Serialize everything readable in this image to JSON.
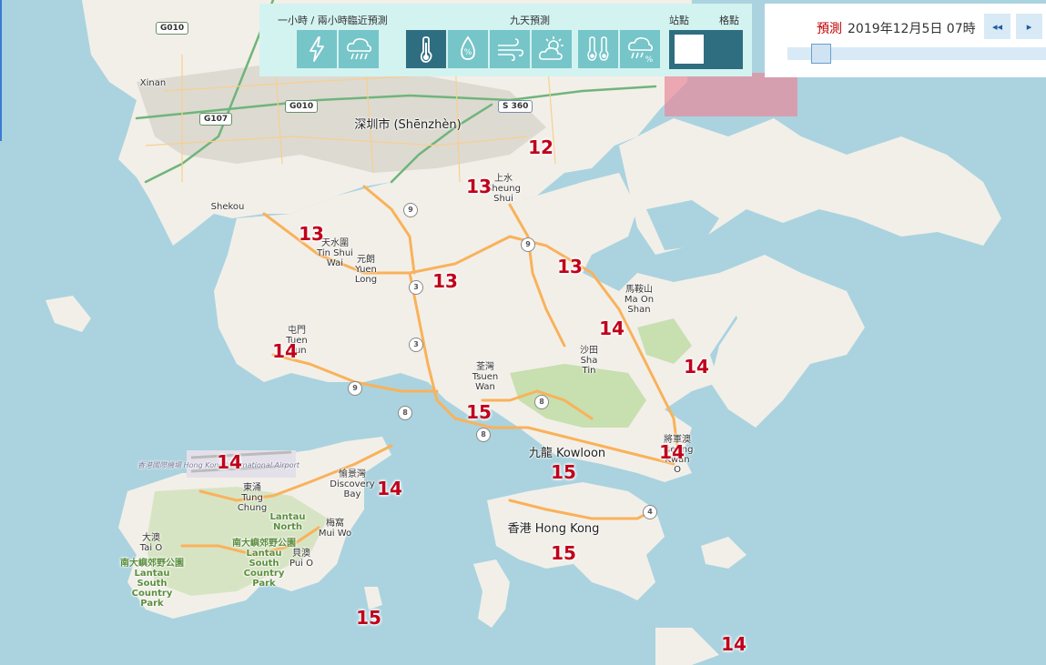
{
  "toolbar": {
    "group_nowcast": "一小時 / 兩小時臨近預測",
    "group_nineday": "九天預測",
    "group_station": "站點",
    "group_grid": "格點",
    "buttons": [
      {
        "name": "lightning-icon",
        "selected": false
      },
      {
        "name": "rain-cloud-icon",
        "selected": false
      },
      {
        "name": "thermometer-icon",
        "selected": true
      },
      {
        "name": "humidity-drop-icon",
        "selected": false
      },
      {
        "name": "wind-icon",
        "selected": false
      },
      {
        "name": "sun-cloud-icon",
        "selected": false
      },
      {
        "name": "max-min-temperature-icon",
        "selected": false
      },
      {
        "name": "rain-probability-icon",
        "selected": false
      }
    ]
  },
  "timepanel": {
    "label": "預測",
    "time": "2019年12月5日 07時",
    "prev_label": "◂◂",
    "next_label": "▸",
    "slider_position_fraction": 0.1
  },
  "places": [
    {
      "name": "place-xinan",
      "text": "Xinan"
    },
    {
      "name": "place-shenzhen",
      "text": "深圳市 (Shēnzhèn)"
    },
    {
      "name": "place-shekou",
      "text": "Shekou"
    },
    {
      "name": "place-sheung-shui",
      "text": "上水\nSheung\nShui"
    },
    {
      "name": "place-tin-shui-wai",
      "text": "天水圍\nTin Shui\nWai"
    },
    {
      "name": "place-yuen-long",
      "text": "元朗\nYuen\nLong"
    },
    {
      "name": "place-ma-on-shan",
      "text": "馬鞍山\nMa On\nShan"
    },
    {
      "name": "place-tuen-mun",
      "text": "屯門\nTuen\nMun"
    },
    {
      "name": "place-sha-tin",
      "text": "沙田\nSha\nTin"
    },
    {
      "name": "place-tsuen-wan",
      "text": "荃灣\nTsuen\nWan"
    },
    {
      "name": "place-kowloon",
      "text": "九龍 Kowloon"
    },
    {
      "name": "place-tseung-kwan-o",
      "text": "將軍澳\nTseung\nKwan\nO"
    },
    {
      "name": "place-discovery-bay",
      "text": "愉景灣\nDiscovery\nBay"
    },
    {
      "name": "place-tung-chung",
      "text": "東涌\nTung\nChung"
    },
    {
      "name": "place-hong-kong",
      "text": "香港 Hong Kong"
    },
    {
      "name": "place-mui-wo",
      "text": "梅窩\nMui Wo"
    },
    {
      "name": "place-tai-o",
      "text": "大澳\nTai O"
    },
    {
      "name": "place-pui-o",
      "text": "貝澳\nPui O"
    },
    {
      "name": "place-airport",
      "text": "香港國際機場 Hong Kong International Airport"
    },
    {
      "name": "place-lantau-north",
      "text": "Lantau\nNorth"
    },
    {
      "name": "place-lantau-south",
      "text": "南大嶼郊野公園\nLantau\nSouth\nCountry\nPark"
    },
    {
      "name": "place-lantau-south-west",
      "text": "南大嶼郊野公園\nLantau\nSouth\nCountry\nPark"
    }
  ],
  "shields": [
    {
      "name": "shield-g010-north",
      "text": "G010"
    },
    {
      "name": "shield-g010-south",
      "text": "G010"
    },
    {
      "name": "shield-g107",
      "text": "G107"
    },
    {
      "name": "shield-s360",
      "text": "S 360"
    }
  ],
  "routes": [
    "9",
    "9",
    "3",
    "3",
    "9",
    "8",
    "8",
    "8",
    "4"
  ],
  "temperatures": [
    {
      "name": "temp-lok-ma-chau",
      "value": "12"
    },
    {
      "name": "temp-sheung-shui",
      "value": "13"
    },
    {
      "name": "temp-tin-shui-wai",
      "value": "13"
    },
    {
      "name": "temp-yuen-long",
      "value": "13"
    },
    {
      "name": "temp-tai-po",
      "value": "13"
    },
    {
      "name": "temp-ma-on-shan",
      "value": "14"
    },
    {
      "name": "temp-tuen-mun",
      "value": "14"
    },
    {
      "name": "temp-sai-kung",
      "value": "14"
    },
    {
      "name": "temp-tsuen-wan",
      "value": "15"
    },
    {
      "name": "temp-airport",
      "value": "14"
    },
    {
      "name": "temp-discovery-bay",
      "value": "14"
    },
    {
      "name": "temp-tseung-kwan-o",
      "value": "14"
    },
    {
      "name": "temp-kowloon",
      "value": "15"
    },
    {
      "name": "temp-hong-kong-island",
      "value": "15"
    },
    {
      "name": "temp-lamma",
      "value": "15"
    },
    {
      "name": "temp-waglan",
      "value": "14"
    }
  ],
  "colors": {
    "sea": "#aad3df",
    "land": "#f2efe9",
    "park": "#c8dfb0",
    "urban": "#dddad2",
    "highway": "#f9b25a",
    "trunk": "#6fb57a",
    "temperature": "#c0001a",
    "toolbar_bg": "#d3f3f1",
    "button": "#76c5c9",
    "button_selected": "#2e6e80"
  }
}
